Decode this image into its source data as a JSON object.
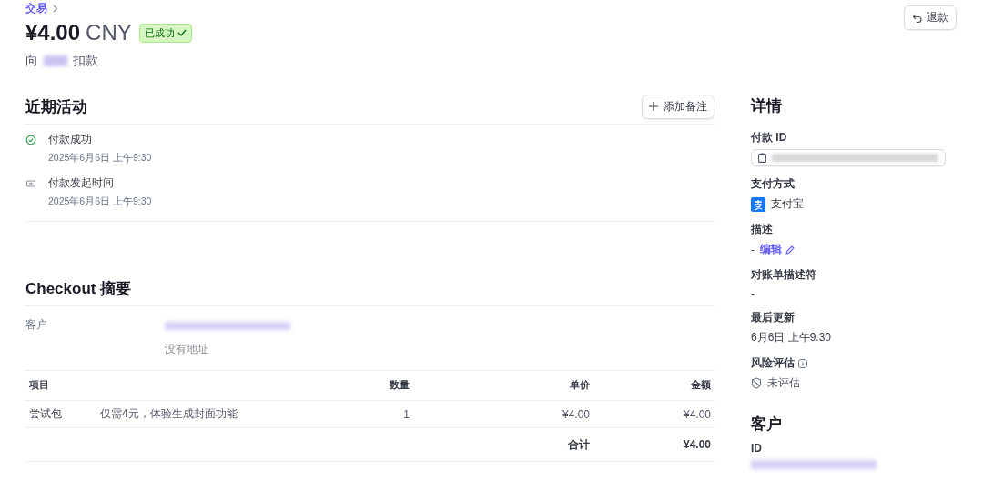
{
  "breadcrumb": {
    "label": "交易"
  },
  "header": {
    "amount": "¥4.00",
    "currency": "CNY",
    "status": {
      "label": "已成功",
      "kind": "success"
    },
    "subtitle_prefix": "向",
    "subtitle_suffix": "扣款",
    "refund_button": "退款"
  },
  "activity": {
    "title": "近期活动",
    "add_note_button": "添加备注",
    "events": [
      {
        "kind": "success",
        "title": "付款成功",
        "time": "2025年6月6日 上午9:30"
      },
      {
        "kind": "started",
        "title": "付款发起时间",
        "time": "2025年6月6日 上午9:30"
      }
    ]
  },
  "checkout": {
    "title": "Checkout 摘要",
    "customer_label": "客户",
    "no_address": "没有地址",
    "table": {
      "columns": [
        "项目",
        "数量",
        "单价",
        "金额"
      ],
      "rows": [
        {
          "item": "尝试包",
          "description": "仅需4元，体验生成封面功能",
          "quantity": "1",
          "unit_price": "¥4.00",
          "amount": "¥4.00"
        }
      ],
      "total_label": "合计",
      "total": "¥4.00"
    }
  },
  "details": {
    "title": "详情",
    "fields": [
      {
        "kind": "id",
        "label": "付款 ID"
      },
      {
        "kind": "method",
        "label": "支付方式",
        "value": "支付宝"
      },
      {
        "kind": "edit",
        "label": "描述",
        "value": "-",
        "link": "编辑"
      },
      {
        "kind": "text",
        "label": "对账单描述符",
        "value": "-"
      },
      {
        "kind": "text",
        "label": "最后更新",
        "value": "6月6日 上午9:30"
      },
      {
        "kind": "risk",
        "label": "风险评估",
        "value": "未评估"
      }
    ]
  },
  "customer": {
    "title": "客户",
    "id_label": "ID"
  }
}
